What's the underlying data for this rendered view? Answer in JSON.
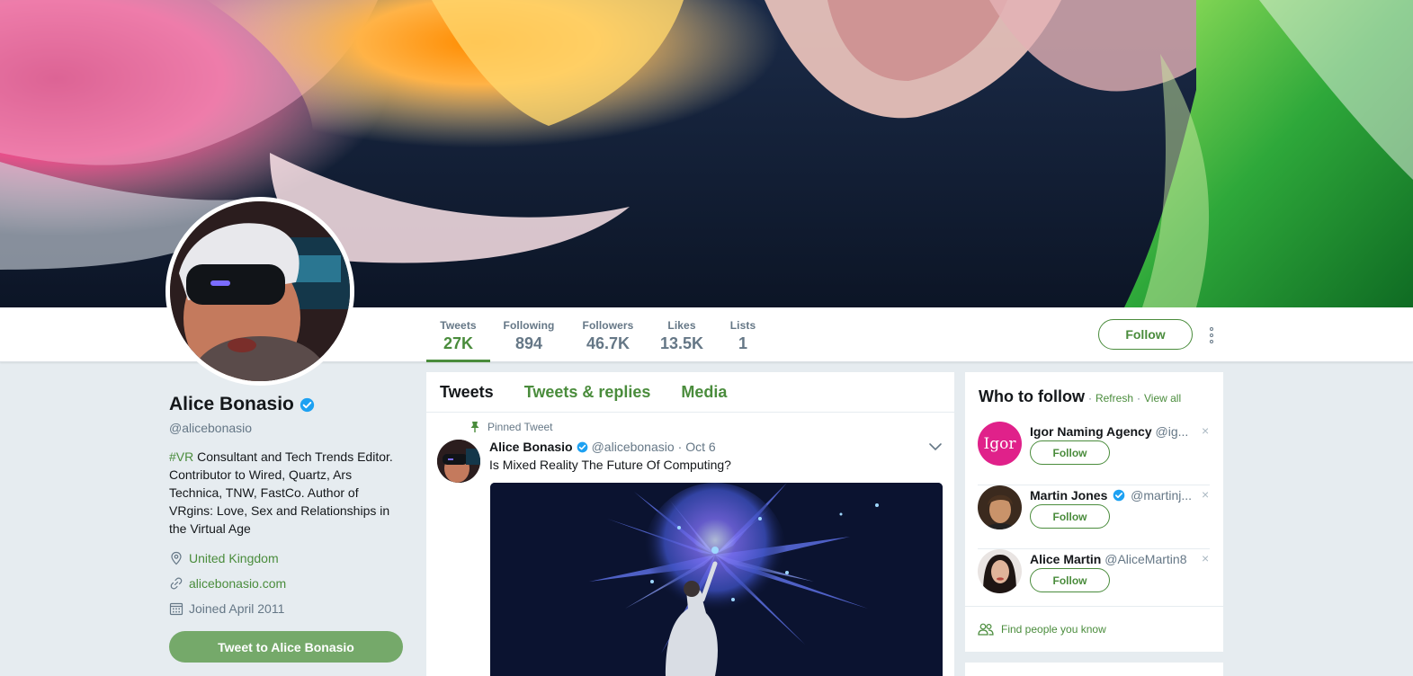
{
  "profile": {
    "name": "Alice Bonasio",
    "handle": "@alicebonasio",
    "bio_hashtag": "#VR",
    "bio_text": " Consultant and Tech Trends Editor. Contributor to Wired, Quartz, Ars Technica, TNW, FastCo. Author of VRgins: Love, Sex and Relationships in the Virtual Age",
    "location": "United Kingdom",
    "website": "alicebonasio.com",
    "joined": "Joined April 2011",
    "tweet_to_label": "Tweet to Alice Bonasio"
  },
  "stats": [
    {
      "label": "Tweets",
      "value": "27K"
    },
    {
      "label": "Following",
      "value": "894"
    },
    {
      "label": "Followers",
      "value": "46.7K"
    },
    {
      "label": "Likes",
      "value": "13.5K"
    },
    {
      "label": "Lists",
      "value": "1"
    }
  ],
  "header": {
    "follow_label": "Follow"
  },
  "timeline": {
    "tabs": [
      "Tweets",
      "Tweets & replies",
      "Media"
    ],
    "pinned_label": "Pinned Tweet",
    "tweet": {
      "author": "Alice Bonasio",
      "handle": "@alicebonasio",
      "date": "· Oct 6",
      "text": "Is Mixed Reality The Future Of Computing?"
    }
  },
  "who_to_follow": {
    "title": "Who to follow",
    "sep1": "·",
    "refresh": "Refresh",
    "sep2": "·",
    "view_all": "View all",
    "suggestions": [
      {
        "name": "Igor Naming Agency",
        "handle": "@ig...",
        "follow": "Follow",
        "close": "×",
        "avatar_text": "Igor"
      },
      {
        "name": "Martin Jones",
        "handle": "@martinj...",
        "follow": "Follow",
        "close": "×"
      },
      {
        "name": "Alice Martin",
        "handle": "@AliceMartin8",
        "follow": "Follow",
        "close": "×"
      }
    ],
    "find_people": "Find people you know"
  },
  "colors": {
    "accent": "#4a8c3c",
    "tweet_button": "#75a96a",
    "verified": "#1da1f2",
    "background": "#e6ecf0"
  }
}
